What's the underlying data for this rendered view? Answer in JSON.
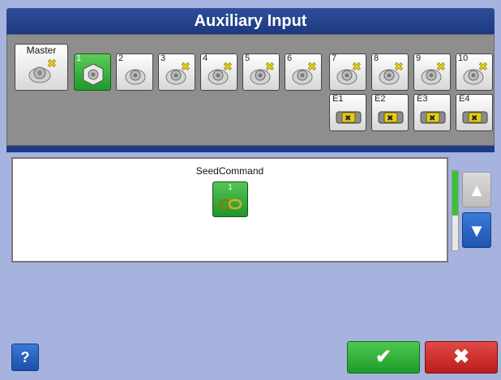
{
  "window": {
    "title": "Auxiliary Input"
  },
  "switches": {
    "master_label": "Master",
    "items": [
      {
        "label": "1",
        "status": "active"
      },
      {
        "label": "2",
        "status": "ok"
      },
      {
        "label": "3",
        "status": "unassigned"
      },
      {
        "label": "4",
        "status": "unassigned"
      },
      {
        "label": "5",
        "status": "unassigned"
      },
      {
        "label": "6",
        "status": "unassigned"
      },
      {
        "label": "7",
        "status": "unassigned"
      },
      {
        "label": "8",
        "status": "unassigned"
      },
      {
        "label": "9",
        "status": "unassigned"
      },
      {
        "label": "10",
        "status": "unassigned"
      }
    ],
    "extras": [
      {
        "label": "E1"
      },
      {
        "label": "E2"
      },
      {
        "label": "E3"
      },
      {
        "label": "E4"
      }
    ]
  },
  "assigned_list": {
    "title": "SeedCommand",
    "function_number": "1",
    "scroll_position": 0.0,
    "up_icon": "▲",
    "down_icon": "▼"
  },
  "footer": {
    "help_label": "?",
    "ok_icon": "✔",
    "cancel_icon": "✖"
  },
  "colors": {
    "title_bar": "#1c3980",
    "panel_bg": "#8e8e8e",
    "selected_green": "#1d9a2a",
    "ok_green": "#1f9b2b",
    "cancel_red": "#bb1d1d",
    "accent_blue": "#1d54b1"
  }
}
